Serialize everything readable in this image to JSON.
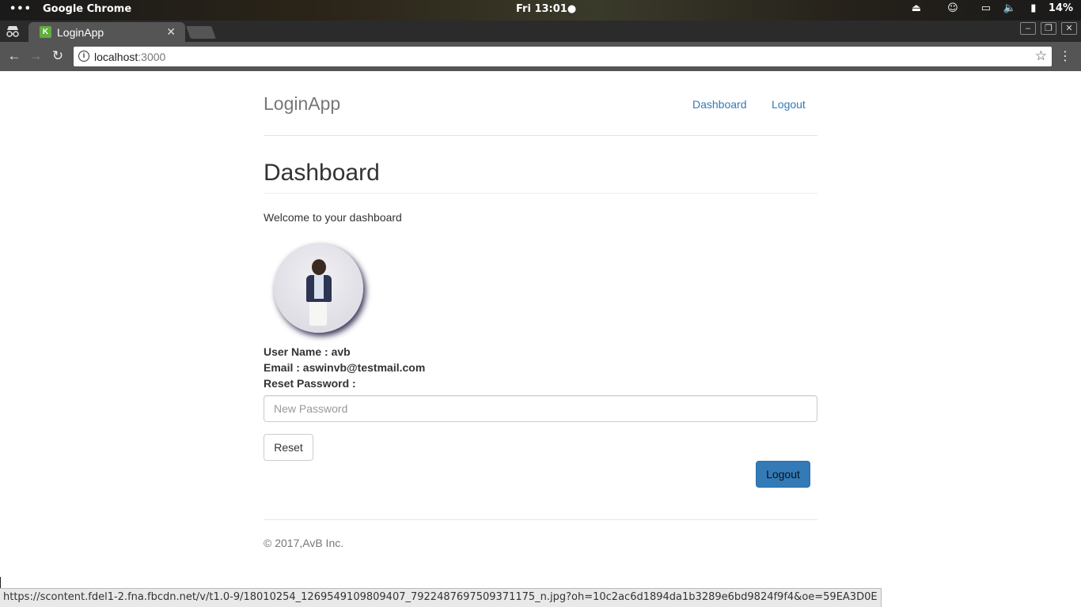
{
  "os_bar": {
    "activities": "•••",
    "app_name": "Google Chrome",
    "clock": "Fri 13:01●",
    "battery_percent": "14%"
  },
  "browser": {
    "tab_title": "LoginApp",
    "tab_favicon_letter": "K",
    "address_host": "localhost",
    "address_port": ":3000",
    "status_url": "https://scontent.fdel1-2.fna.fbcdn.net/v/t1.0-9/18010254_1269549109809407_7922487697509371175_n.jpg?oh=10c2ac6d1894da1b3289e6bd9824f9f4&oe=59EA3D0E"
  },
  "navbar": {
    "brand": "LoginApp",
    "links": [
      "Dashboard",
      "Logout"
    ]
  },
  "main": {
    "heading": "Dashboard",
    "welcome": "Welcome to your dashboard",
    "user_name_line": "User Name : avb",
    "email_line": "Email : aswinvb@testmail.com",
    "reset_label": "Reset Password :",
    "password_placeholder": "New Password",
    "reset_button": "Reset",
    "logout_button": "Logout"
  },
  "footer": {
    "text": "© 2017,AvB Inc."
  },
  "colors": {
    "link": "#337ab7",
    "primary_button": "#337ab7"
  }
}
